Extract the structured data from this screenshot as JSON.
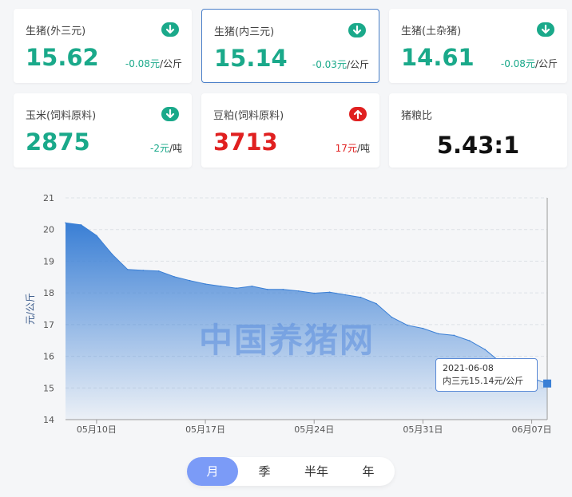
{
  "cards": [
    {
      "title": "生猪(外三元)",
      "price": "15.62",
      "change": "-0.08元",
      "unit": "/公斤",
      "trend": "down"
    },
    {
      "title": "生猪(内三元)",
      "price": "15.14",
      "change": "-0.03元",
      "unit": "/公斤",
      "trend": "down",
      "selected": true
    },
    {
      "title": "生猪(土杂猪)",
      "price": "14.61",
      "change": "-0.08元",
      "unit": "/公斤",
      "trend": "down"
    },
    {
      "title": "玉米(饲料原料)",
      "price": "2875",
      "change": "-2元",
      "unit": "/吨",
      "trend": "down"
    },
    {
      "title": "豆粕(饲料原料)",
      "price": "3713",
      "change": "17元",
      "unit": "/吨",
      "trend": "up"
    },
    {
      "title": "猪粮比",
      "ratio": "5.43:1"
    }
  ],
  "colors": {
    "down": "#1aa98a",
    "up": "#e02020",
    "accent": "#3a7fd5",
    "tab_active": "#7b9bf7"
  },
  "watermark": "中国养猪网",
  "tooltip": {
    "date": "2021-06-08",
    "text": "内三元15.14元/公斤"
  },
  "tabs": [
    "月",
    "季",
    "半年",
    "年"
  ],
  "active_tab": 0,
  "chart_data": {
    "type": "area",
    "ylabel": "元/公斤",
    "xlabel": "",
    "ylim": [
      14,
      21
    ],
    "yticks": [
      14,
      15,
      16,
      17,
      18,
      19,
      20,
      21
    ],
    "xlim": [
      "2021-05-08",
      "2021-06-08"
    ],
    "xticks": [
      "05月10日",
      "05月17日",
      "05月24日",
      "05月31日",
      "06月07日"
    ],
    "xtick_dates": [
      "2021-05-10",
      "2021-05-17",
      "2021-05-24",
      "2021-05-31",
      "2021-06-07"
    ],
    "grid": true,
    "series": [
      {
        "x": [
          "2021-05-08",
          "2021-05-09",
          "2021-05-10",
          "2021-05-11",
          "2021-05-12",
          "2021-05-13",
          "2021-05-14",
          "2021-05-15",
          "2021-05-16",
          "2021-05-17",
          "2021-05-18",
          "2021-05-19",
          "2021-05-20",
          "2021-05-21",
          "2021-05-22",
          "2021-05-23",
          "2021-05-24",
          "2021-05-25",
          "2021-05-26",
          "2021-05-27",
          "2021-05-28",
          "2021-05-29",
          "2021-05-30",
          "2021-05-31",
          "2021-06-01",
          "2021-06-02",
          "2021-06-03",
          "2021-06-04",
          "2021-06-05",
          "2021-06-06",
          "2021-06-07",
          "2021-06-08"
        ],
        "values": [
          20.21,
          20.15,
          19.81,
          19.22,
          18.74,
          18.71,
          18.69,
          18.51,
          18.39,
          18.28,
          18.21,
          18.15,
          18.21,
          18.11,
          18.11,
          18.06,
          17.99,
          18.02,
          17.94,
          17.86,
          17.66,
          17.23,
          16.98,
          16.88,
          16.71,
          16.66,
          16.49,
          16.21,
          15.81,
          15.51,
          15.31,
          15.14
        ]
      }
    ]
  }
}
